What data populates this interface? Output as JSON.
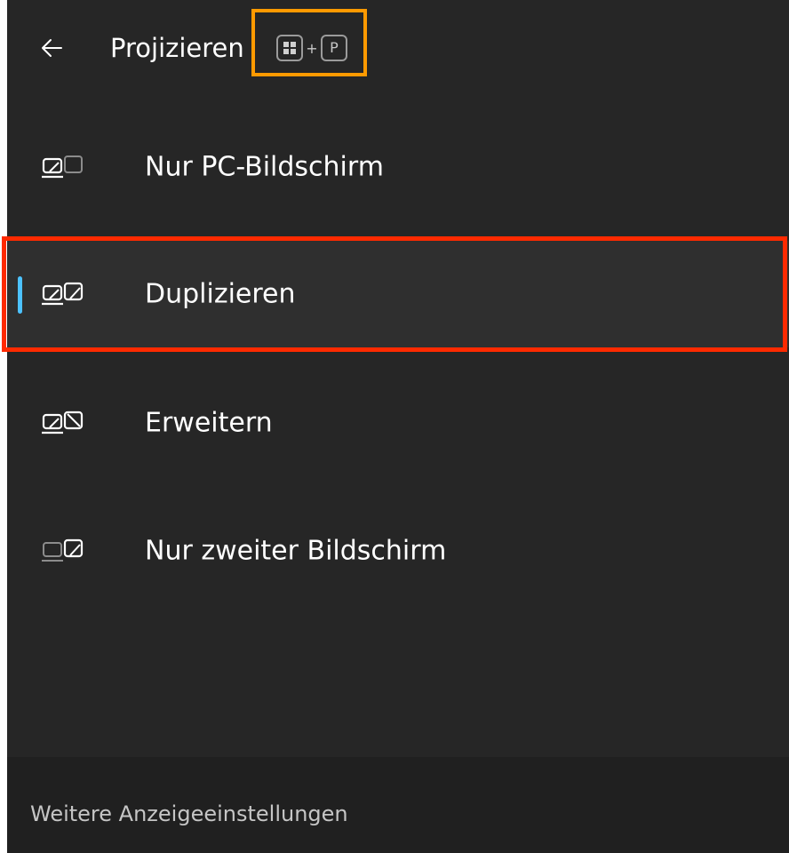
{
  "header": {
    "title": "Projizieren",
    "shortcut": {
      "key1": "windows-key",
      "plus": "+",
      "key2": "P"
    }
  },
  "options": [
    {
      "label": "Nur PC-Bildschirm",
      "icon": "pc-screen-only-icon",
      "selected": false
    },
    {
      "label": "Duplizieren",
      "icon": "duplicate-icon",
      "selected": true
    },
    {
      "label": "Erweitern",
      "icon": "extend-icon",
      "selected": false
    },
    {
      "label": "Nur zweiter Bildschirm",
      "icon": "second-screen-only-icon",
      "selected": false
    }
  ],
  "footer": {
    "link": "Weitere Anzeigeeinstellungen"
  },
  "colors": {
    "panel_bg": "#262626",
    "selected_bg": "#2f2f2f",
    "accent": "#4cc2ff",
    "annotation_orange": "#ff9a00",
    "annotation_red": "#ff2a00"
  }
}
